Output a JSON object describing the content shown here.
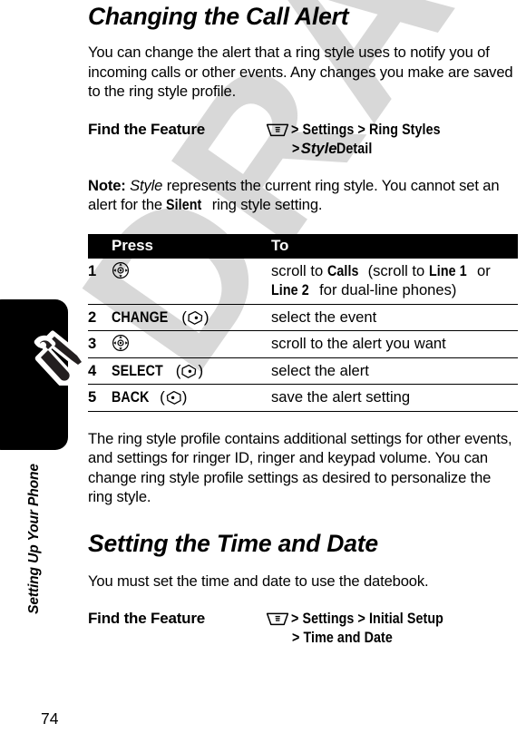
{
  "watermark": {
    "text": "DRAFT",
    "color": "#d8d8d8"
  },
  "side_tab": {
    "label": "Setting Up Your Phone",
    "icon": "wrench-screwdriver-icon",
    "page_number": "74"
  },
  "sections": [
    {
      "heading": "Changing the Call Alert",
      "intro": "You can change the alert that a ring style uses to notify you of incoming calls or other events. Any changes you make are saved to the ring style profile.",
      "find_the_feature": {
        "label": "Find the Feature",
        "key_icon": "menu-key-icon",
        "line1": "> Settings > Ring Styles",
        "line2_prefix": "> ",
        "line2_italic": "Style",
        "line2_suffix": " Detail",
        "path_items": [
          "Settings",
          "Ring Styles",
          "Style Detail"
        ]
      },
      "note": {
        "prefix": "Note:",
        "italic_word": "Style",
        "text_part1": " represents the current ring style. You cannot set an alert for the ",
        "bold_word": "Silent",
        "text_part2": " ring style setting."
      },
      "table": {
        "headers": {
          "num": "",
          "press": "Press",
          "to": "To"
        },
        "rows": [
          {
            "num": "1",
            "press_icon": "nav-key-icon",
            "press_label": "",
            "to_parts": [
              {
                "text": "scroll to ",
                "style": "normal"
              },
              {
                "text": "Calls",
                "style": "keycap"
              },
              {
                "text": " (scroll to ",
                "style": "normal"
              },
              {
                "text": "Line 1",
                "style": "keycap"
              },
              {
                "text": " or ",
                "style": "normal"
              },
              {
                "text": "Line 2",
                "style": "keycap"
              },
              {
                "text": " for dual-line phones)",
                "style": "normal"
              }
            ],
            "to_plain": "scroll to Calls (scroll to Line 1 or Line 2 for dual-line phones)"
          },
          {
            "num": "2",
            "press_icon": "soft-key-right-icon",
            "press_label": "CHANGE",
            "to_parts": [
              {
                "text": "select the event",
                "style": "normal"
              }
            ],
            "to_plain": "select the event"
          },
          {
            "num": "3",
            "press_icon": "nav-key-icon",
            "press_label": "",
            "to_parts": [
              {
                "text": "scroll to the alert you want",
                "style": "normal"
              }
            ],
            "to_plain": "scroll to the alert you want"
          },
          {
            "num": "4",
            "press_icon": "soft-key-right-icon",
            "press_label": "SELECT",
            "to_parts": [
              {
                "text": "select the alert",
                "style": "normal"
              }
            ],
            "to_plain": "select the alert"
          },
          {
            "num": "5",
            "press_icon": "soft-key-left-icon",
            "press_label": "BACK",
            "to_parts": [
              {
                "text": "save the alert setting",
                "style": "normal"
              }
            ],
            "to_plain": "save the alert setting"
          }
        ]
      },
      "outro": "The ring style profile contains additional settings for other events, and settings for ringer ID, ringer and keypad volume. You can change ring style profile settings as desired to personalize the ring style."
    },
    {
      "heading": "Setting the Time and Date",
      "intro": "You must set the time and date to use the datebook.",
      "find_the_feature": {
        "label": "Find the Feature",
        "key_icon": "menu-key-icon",
        "line1": "> Settings > Initial Setup",
        "line2": "> Time and Date",
        "path_items": [
          "Settings",
          "Initial Setup",
          "Time and Date"
        ]
      }
    }
  ]
}
